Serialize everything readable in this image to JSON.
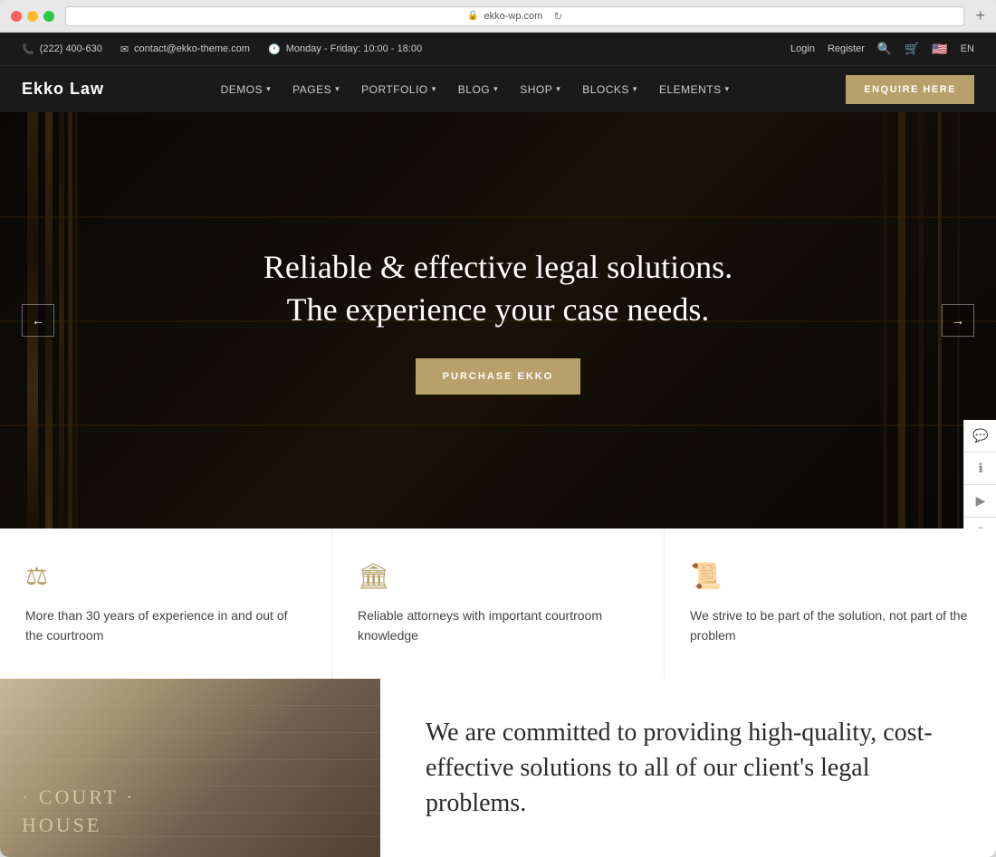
{
  "browser": {
    "url": "ekko-wp.com",
    "plus_label": "+",
    "refresh_symbol": "↻"
  },
  "topbar": {
    "phone": "(222) 400-630",
    "email": "contact@ekko-theme.com",
    "hours": "Monday - Friday: 10:00 - 18:00",
    "login": "Login",
    "register": "Register",
    "lang": "EN"
  },
  "navbar": {
    "brand": "Ekko Law",
    "menu": [
      {
        "label": "DEMOS",
        "has_dropdown": true
      },
      {
        "label": "PAGES",
        "has_dropdown": true
      },
      {
        "label": "PORTFOLIO",
        "has_dropdown": true
      },
      {
        "label": "BLOG",
        "has_dropdown": true
      },
      {
        "label": "SHOP",
        "has_dropdown": true
      },
      {
        "label": "BLOCKS",
        "has_dropdown": true
      },
      {
        "label": "ELEMENTS",
        "has_dropdown": true
      }
    ],
    "cta": "ENQUIRE HERE"
  },
  "hero": {
    "title_line1": "Reliable & effective legal solutions.",
    "title_line2": "The experience your case needs.",
    "button_label": "PURCHASE EKKO",
    "arrow_left": "←",
    "arrow_right": "→"
  },
  "features": [
    {
      "icon": "⚖",
      "text": "More than 30 years of experience in and out of the courtroom"
    },
    {
      "icon": "🏛",
      "text": "Reliable attorneys with important courtroom knowledge"
    },
    {
      "icon": "📜",
      "text": "We strive to be part of the solution, not part of the problem"
    }
  ],
  "bottom": {
    "image_text_line1": "· COURT ·",
    "image_text_line2": "HOUSE",
    "quote": "We are committed to providing high-quality, cost-effective solutions to all of our client's legal problems."
  },
  "sidebar_icons": [
    "💬",
    "ℹ",
    "▶",
    "🔒"
  ]
}
